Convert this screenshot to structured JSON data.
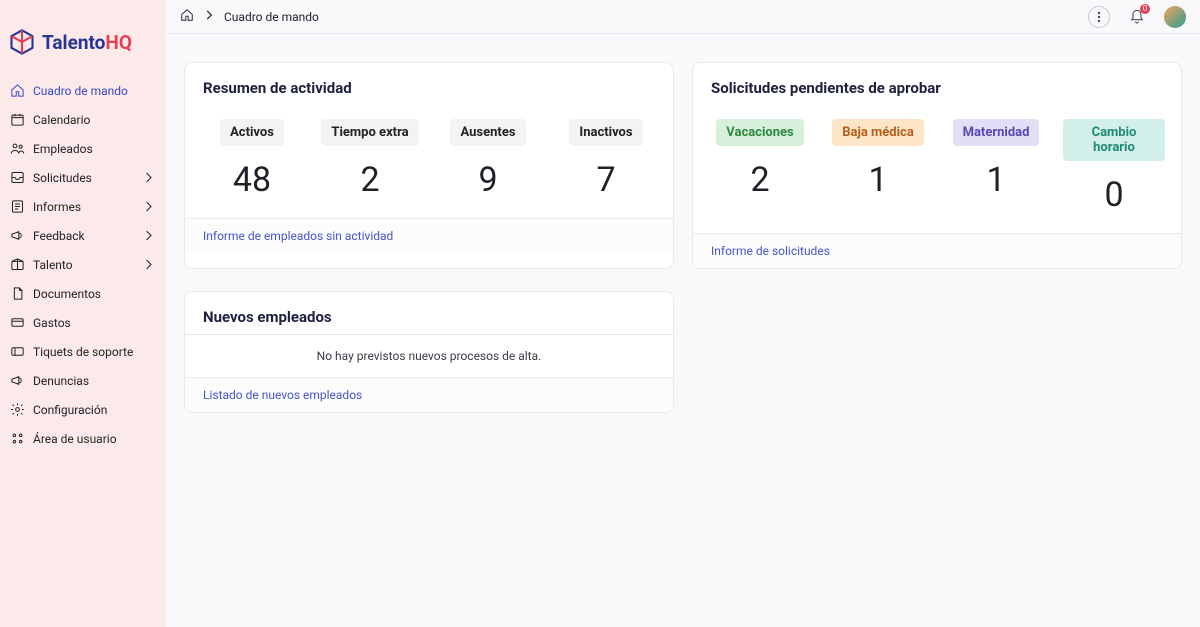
{
  "brand": {
    "name_a": "Talento",
    "name_b": "HQ"
  },
  "breadcrumb": {
    "title": "Cuadro de mando"
  },
  "notifications": {
    "count": "0"
  },
  "sidebar": {
    "items": [
      {
        "label": "Cuadro de mando",
        "icon": "home",
        "active": true
      },
      {
        "label": "Calendario",
        "icon": "calendar"
      },
      {
        "label": "Empleados",
        "icon": "users"
      },
      {
        "label": "Solicitudes",
        "icon": "inbox",
        "chevron": true
      },
      {
        "label": "Informes",
        "icon": "report",
        "chevron": true
      },
      {
        "label": "Feedback",
        "icon": "megaphone",
        "chevron": true
      },
      {
        "label": "Talento",
        "icon": "box",
        "chevron": true
      },
      {
        "label": "Documentos",
        "icon": "doc"
      },
      {
        "label": "Gastos",
        "icon": "card"
      },
      {
        "label": "Tiquets de soporte",
        "icon": "ticket"
      },
      {
        "label": "Denuncias",
        "icon": "alert"
      },
      {
        "label": "Configuración",
        "icon": "gear"
      },
      {
        "label": "Área de usuario",
        "icon": "userarea"
      }
    ]
  },
  "activity": {
    "title": "Resumen de actividad",
    "stats": [
      {
        "label": "Activos",
        "value": "48"
      },
      {
        "label": "Tiempo extra",
        "value": "2"
      },
      {
        "label": "Ausentes",
        "value": "9"
      },
      {
        "label": "Inactivos",
        "value": "7"
      }
    ],
    "link": "Informe de empleados sin actividad"
  },
  "requests": {
    "title": "Solicitudes pendientes de aprobar",
    "stats": [
      {
        "label": "Vacaciones",
        "value": "2",
        "cls": "green"
      },
      {
        "label": "Baja médica",
        "value": "1",
        "cls": "orange"
      },
      {
        "label": "Maternidad",
        "value": "1",
        "cls": "purple"
      },
      {
        "label": "Cambio horario",
        "value": "0",
        "cls": "teal"
      }
    ],
    "link": "Informe de solicitudes"
  },
  "new_employees": {
    "title": "Nuevos empleados",
    "empty": "No hay previstos nuevos procesos de alta.",
    "link": "Listado de nuevos empleados"
  }
}
